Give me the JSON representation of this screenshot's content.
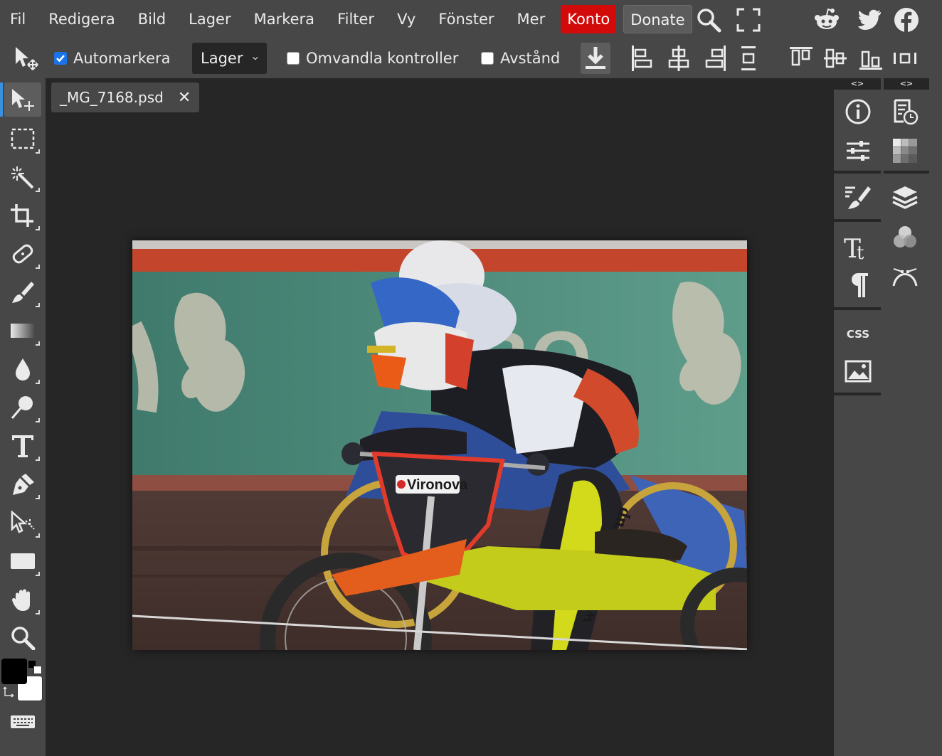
{
  "menubar": {
    "items": [
      "Fil",
      "Redigera",
      "Bild",
      "Lager",
      "Markera",
      "Filter",
      "Vy",
      "Fönster",
      "Mer"
    ],
    "konto_label": "Konto",
    "donate_label": "Donate"
  },
  "options": {
    "automarkera_label": "Automarkera",
    "automarkera_checked": true,
    "select_value": "Lager",
    "omvandla_label": "Omvandla kontroller",
    "omvandla_checked": false,
    "avstand_label": "Avstånd",
    "avstand_checked": false
  },
  "document": {
    "tab_name": "_MG_7168.psd",
    "close_symbol": "✕"
  },
  "panels": {
    "collapse_left": "<>",
    "collapse_right": "<>",
    "css_label": "CSS"
  },
  "colors": {
    "accent": "#1a73e8",
    "konto": "#d20a0a",
    "active_tool": "#3a8fde",
    "chrome": "#474747",
    "workspace": "#262626"
  },
  "photo": {
    "sponsor_text": "Vironova"
  }
}
